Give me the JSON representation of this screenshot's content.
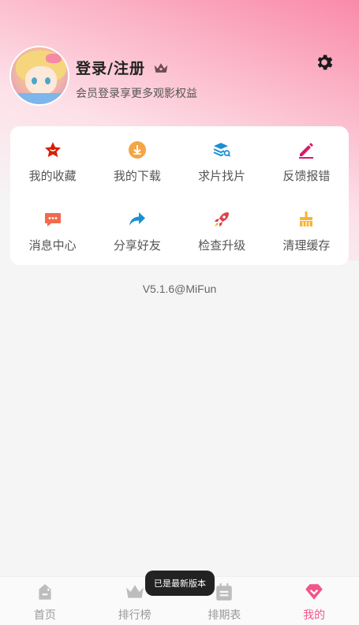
{
  "profile": {
    "title": "登录/注册",
    "subtitle": "会员登录享更多观影权益"
  },
  "grid": {
    "items": [
      {
        "label": "我的收藏",
        "icon": "star-icon",
        "color": "#d81e06"
      },
      {
        "label": "我的下载",
        "icon": "download-cloud-icon",
        "color": "#f4a545"
      },
      {
        "label": "求片找片",
        "icon": "search-stack-icon",
        "color": "#1a8fd6"
      },
      {
        "label": "反馈报错",
        "icon": "pencil-icon",
        "color": "#d6196b"
      },
      {
        "label": "消息中心",
        "icon": "message-icon",
        "color": "#f26a4b"
      },
      {
        "label": "分享好友",
        "icon": "share-arrow-icon",
        "color": "#1a8fd6"
      },
      {
        "label": "检查升级",
        "icon": "rocket-icon",
        "color": "#e04045"
      },
      {
        "label": "清理缓存",
        "icon": "broom-icon",
        "color": "#f5b532"
      }
    ]
  },
  "version": "V5.1.6@MiFun",
  "tabs": [
    {
      "label": "首页",
      "icon": "home-icon"
    },
    {
      "label": "排行榜",
      "icon": "crown-icon"
    },
    {
      "label": "排期表",
      "icon": "calendar-icon"
    },
    {
      "label": "我的",
      "icon": "heart-diamond-icon"
    }
  ],
  "toast": "已是最新版本",
  "colors": {
    "accent": "#f0568c",
    "inactive": "#bdbdbd"
  }
}
